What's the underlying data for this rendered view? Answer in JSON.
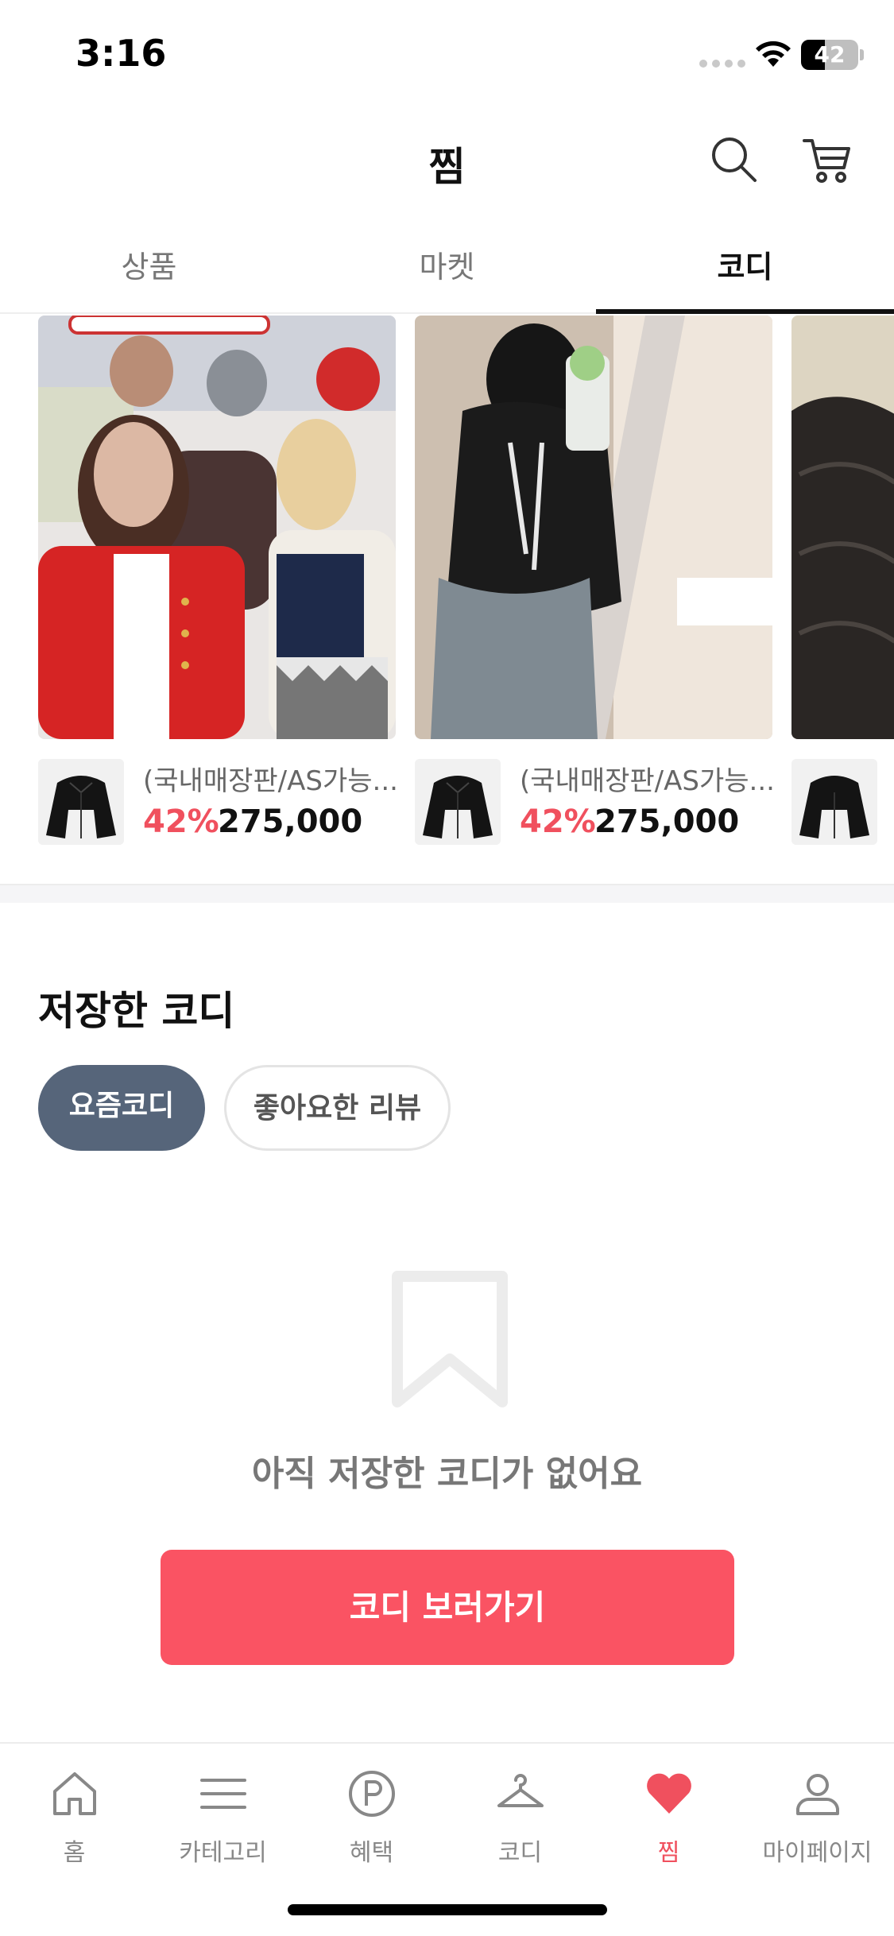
{
  "status_bar": {
    "time": "3:16",
    "battery": "42",
    "battery_level": 0.42
  },
  "header": {
    "title": "찜",
    "icons": [
      "search-icon",
      "cart-icon"
    ]
  },
  "tabs": [
    {
      "label": "상품",
      "active": false
    },
    {
      "label": "마켓",
      "active": false
    },
    {
      "label": "코디",
      "active": true
    }
  ],
  "carousel": {
    "cards": [
      {
        "product_name": "(국내매장판/AS가능...",
        "discount": "42%",
        "price": "275,000"
      },
      {
        "product_name": "(국내매장판/AS가능...",
        "discount": "42%",
        "price": "275,000"
      },
      {
        "product_name": "",
        "discount": "",
        "price": ""
      }
    ]
  },
  "saved": {
    "title": "저장한 코디",
    "chips": [
      {
        "label": "요즘코디",
        "active": true
      },
      {
        "label": "좋아요한 리뷰",
        "active": false
      }
    ],
    "empty_message": "아직 저장한 코디가 없어요",
    "cta_label": "코디 보러가기"
  },
  "bottom_nav": [
    {
      "label": "홈",
      "icon": "home-icon",
      "active": false
    },
    {
      "label": "카테고리",
      "icon": "menu-icon",
      "active": false
    },
    {
      "label": "혜택",
      "icon": "points-icon",
      "active": false
    },
    {
      "label": "코디",
      "icon": "hanger-icon",
      "active": false
    },
    {
      "label": "찜",
      "icon": "heart-icon",
      "active": true
    },
    {
      "label": "마이페이지",
      "icon": "person-icon",
      "active": false
    }
  ],
  "colors": {
    "accent": "#fa5363",
    "discount": "#f0505e",
    "chip_active": "#56657a"
  }
}
